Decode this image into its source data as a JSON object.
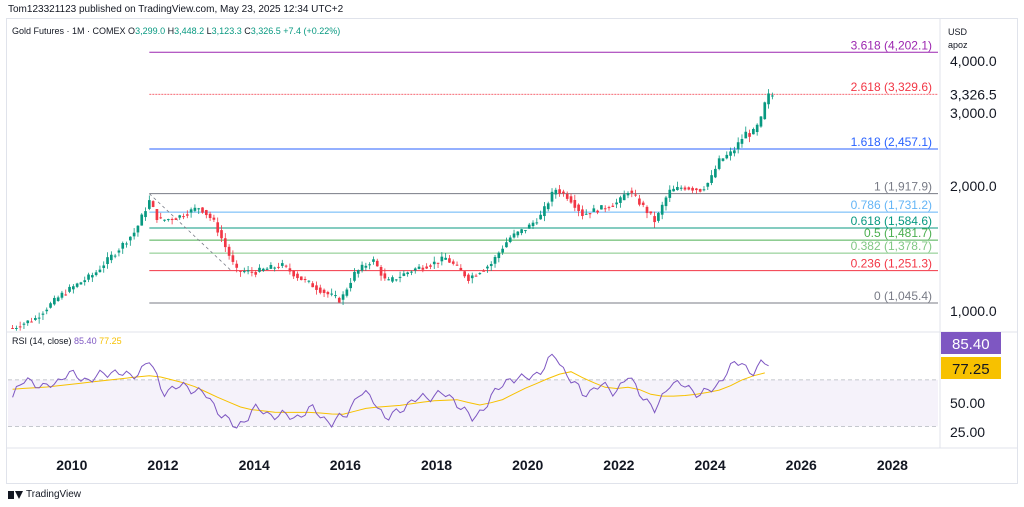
{
  "header": {
    "published": "Tom123321123 published on TradingView.com, May 23, 2025 12:34 UTC+2"
  },
  "legend": {
    "symbol": "Gold Futures · 1M · COMEX",
    "open_label": "O",
    "open": "3,299.0",
    "high_label": "H",
    "high": "3,448.2",
    "low_label": "L",
    "low": "3,123.3",
    "close_label": "C",
    "close": "3,326.5",
    "change": "+7.4 (+0.22%)"
  },
  "axis_header": {
    "currency": "USD",
    "scale_mode": "apoz"
  },
  "rsi_legend": {
    "name": "RSI (14, close)",
    "rsi": "85.40",
    "ma": "77.25"
  },
  "footer": {
    "brand": "TradingView"
  },
  "colors": {
    "up": "#089981",
    "down": "#f23645",
    "rsi": "#7e57c2",
    "rsi_ma": "#f7c100",
    "fib_top": "#9c27b0",
    "fib_2618": "#f23645",
    "fib_1618": "#2962ff"
  },
  "chart_data": {
    "type": "candlestick",
    "interval": "1M",
    "price_scale": "log",
    "ylim": [
      900,
      4600
    ],
    "xlim": [
      2008.6,
      2029.0
    ],
    "x_ticks": [
      2010,
      2012,
      2014,
      2016,
      2018,
      2020,
      2022,
      2024,
      2026,
      2028
    ],
    "y_ticks": [
      {
        "value": 1000,
        "label": "1,000.0"
      },
      {
        "value": 2000,
        "label": "2,000.0"
      },
      {
        "value": 3000,
        "label": "3,000.0"
      },
      {
        "value": 4000,
        "label": "4,000.0"
      }
    ],
    "last_price": {
      "value": 3326.5,
      "label": "3,326.5"
    },
    "price_keypoints": [
      [
        2008.7,
        910
      ],
      [
        2009.2,
        960
      ],
      [
        2009.8,
        1100
      ],
      [
        2010.5,
        1230
      ],
      [
        2011.0,
        1400
      ],
      [
        2011.4,
        1560
      ],
      [
        2011.7,
        1840
      ],
      [
        2011.9,
        1650
      ],
      [
        2012.3,
        1680
      ],
      [
        2012.8,
        1780
      ],
      [
        2013.1,
        1650
      ],
      [
        2013.4,
        1400
      ],
      [
        2013.6,
        1250
      ],
      [
        2014.0,
        1240
      ],
      [
        2014.6,
        1290
      ],
      [
        2015.0,
        1200
      ],
      [
        2015.6,
        1100
      ],
      [
        2015.9,
        1060
      ],
      [
        2016.2,
        1230
      ],
      [
        2016.6,
        1330
      ],
      [
        2016.9,
        1170
      ],
      [
        2017.5,
        1260
      ],
      [
        2017.9,
        1300
      ],
      [
        2018.2,
        1340
      ],
      [
        2018.7,
        1200
      ],
      [
        2019.2,
        1300
      ],
      [
        2019.6,
        1500
      ],
      [
        2020.0,
        1590
      ],
      [
        2020.3,
        1700
      ],
      [
        2020.6,
        1970
      ],
      [
        2020.9,
        1880
      ],
      [
        2021.2,
        1710
      ],
      [
        2021.7,
        1780
      ],
      [
        2022.0,
        1830
      ],
      [
        2022.2,
        1950
      ],
      [
        2022.5,
        1800
      ],
      [
        2022.8,
        1640
      ],
      [
        2023.1,
        1940
      ],
      [
        2023.4,
        1990
      ],
      [
        2023.8,
        1960
      ],
      [
        2024.0,
        2060
      ],
      [
        2024.2,
        2300
      ],
      [
        2024.5,
        2420
      ],
      [
        2024.8,
        2700
      ],
      [
        2024.9,
        2650
      ],
      [
        2025.1,
        2850
      ],
      [
        2025.25,
        3300
      ],
      [
        2025.33,
        3310
      ]
    ],
    "fib_levels": [
      {
        "ratio": "3.618",
        "value": 4202.1,
        "label": "3.618 (4,202.1)",
        "color": "#9c27b0"
      },
      {
        "ratio": "2.618",
        "value": 3329.6,
        "label": "2.618 (3,329.6)",
        "color": "#f23645"
      },
      {
        "ratio": "1.618",
        "value": 2457.1,
        "label": "1.618 (2,457.1)",
        "color": "#2962ff"
      },
      {
        "ratio": "1",
        "value": 1917.9,
        "label": "1 (1,917.9)",
        "color": "#787b86"
      },
      {
        "ratio": "0.786",
        "value": 1731.2,
        "label": "0.786 (1,731.2)",
        "color": "#64b5f6"
      },
      {
        "ratio": "0.618",
        "value": 1584.6,
        "label": "0.618 (1,584.6)",
        "color": "#089981"
      },
      {
        "ratio": "0.5",
        "value": 1481.7,
        "label": "0.5 (1,481.7)",
        "color": "#4caf50"
      },
      {
        "ratio": "0.382",
        "value": 1378.7,
        "label": "0.382 (1,378.7)",
        "color": "#81c784"
      },
      {
        "ratio": "0.236",
        "value": 1251.3,
        "label": "0.236 (1,251.3)",
        "color": "#f23645"
      },
      {
        "ratio": "0",
        "value": 1045.4,
        "label": "0 (1,045.4)",
        "color": "#787b86"
      }
    ],
    "rsi": {
      "ylim": [
        20,
        100
      ],
      "bands": [
        70,
        30
      ],
      "y_ticks": [
        {
          "value": 50,
          "label": "50.00"
        },
        {
          "value": 25,
          "label": "25.00"
        }
      ],
      "last_rsi": {
        "value": 85.4,
        "label": "85.40"
      },
      "last_ma": {
        "value": 77.25,
        "label": "77.25"
      },
      "keypoints": [
        [
          2008.7,
          55
        ],
        [
          2009.0,
          72
        ],
        [
          2009.4,
          62
        ],
        [
          2009.9,
          75
        ],
        [
          2010.4,
          70
        ],
        [
          2010.9,
          78
        ],
        [
          2011.3,
          72
        ],
        [
          2011.7,
          86
        ],
        [
          2012.0,
          60
        ],
        [
          2012.5,
          65
        ],
        [
          2012.9,
          58
        ],
        [
          2013.3,
          40
        ],
        [
          2013.6,
          28
        ],
        [
          2014.0,
          45
        ],
        [
          2014.4,
          40
        ],
        [
          2014.9,
          38
        ],
        [
          2015.3,
          45
        ],
        [
          2015.7,
          32
        ],
        [
          2016.0,
          40
        ],
        [
          2016.3,
          58
        ],
        [
          2016.6,
          55
        ],
        [
          2016.9,
          35
        ],
        [
          2017.3,
          48
        ],
        [
          2017.7,
          55
        ],
        [
          2018.1,
          58
        ],
        [
          2018.4,
          53
        ],
        [
          2018.8,
          35
        ],
        [
          2019.2,
          55
        ],
        [
          2019.6,
          72
        ],
        [
          2019.9,
          70
        ],
        [
          2020.3,
          78
        ],
        [
          2020.6,
          92
        ],
        [
          2020.9,
          72
        ],
        [
          2021.2,
          58
        ],
        [
          2021.6,
          65
        ],
        [
          2021.9,
          60
        ],
        [
          2022.2,
          72
        ],
        [
          2022.5,
          58
        ],
        [
          2022.8,
          42
        ],
        [
          2023.1,
          68
        ],
        [
          2023.4,
          65
        ],
        [
          2023.8,
          58
        ],
        [
          2024.1,
          62
        ],
        [
          2024.4,
          80
        ],
        [
          2024.7,
          85
        ],
        [
          2024.9,
          76
        ],
        [
          2025.1,
          82
        ],
        [
          2025.33,
          85.4
        ]
      ],
      "ma_keypoints": [
        [
          2008.7,
          62
        ],
        [
          2009.5,
          64
        ],
        [
          2010.4,
          68
        ],
        [
          2011.3,
          72
        ],
        [
          2011.8,
          74
        ],
        [
          2012.6,
          66
        ],
        [
          2013.2,
          55
        ],
        [
          2013.8,
          45
        ],
        [
          2014.5,
          42
        ],
        [
          2015.3,
          42
        ],
        [
          2015.9,
          40
        ],
        [
          2016.5,
          46
        ],
        [
          2017.2,
          48
        ],
        [
          2017.9,
          52
        ],
        [
          2018.5,
          53
        ],
        [
          2018.9,
          48
        ],
        [
          2019.4,
          52
        ],
        [
          2019.9,
          62
        ],
        [
          2020.5,
          72
        ],
        [
          2020.9,
          78
        ],
        [
          2021.3,
          70
        ],
        [
          2021.8,
          62
        ],
        [
          2022.3,
          64
        ],
        [
          2022.8,
          56
        ],
        [
          2023.3,
          56
        ],
        [
          2023.8,
          58
        ],
        [
          2024.3,
          62
        ],
        [
          2024.8,
          72
        ],
        [
          2025.33,
          77.25
        ]
      ]
    }
  }
}
